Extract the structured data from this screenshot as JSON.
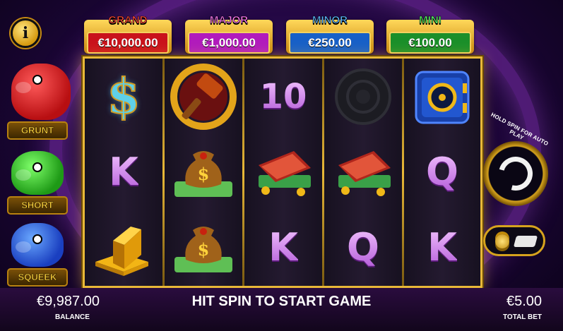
{
  "jackpots": [
    {
      "name": "GRAND",
      "value": "€10,000.00",
      "color": "#c9121c"
    },
    {
      "name": "MAJOR",
      "value": "€1,000.00",
      "color": "#b11bbd"
    },
    {
      "name": "MINOR",
      "value": "€250.00",
      "color": "#1760c8"
    },
    {
      "name": "MINI",
      "value": "€100.00",
      "color": "#1a8f2a"
    }
  ],
  "pigs": [
    {
      "label": "GRUNT",
      "icon": "red-piggy-bank-icon"
    },
    {
      "label": "SHORT",
      "icon": "green-piggy-bank-icon"
    },
    {
      "label": "SQUEEK",
      "icon": "blue-piggy-bank-icon"
    }
  ],
  "reels": {
    "symbols": [
      [
        "dollar",
        "K",
        "gold-bars"
      ],
      [
        "hammer",
        "money-bag",
        "money-bag"
      ],
      [
        "10",
        "wallet",
        "K"
      ],
      [
        "empty",
        "wallet",
        "Q"
      ],
      [
        "safe",
        "Q",
        "K"
      ]
    ],
    "labels": {
      "c0r0": "$",
      "c0r1": "K",
      "c2r0": "10",
      "c2r2": "K",
      "c3r2": "Q",
      "c4r1": "Q",
      "c4r2": "K"
    }
  },
  "controls": {
    "spin_hint": "HOLD SPIN FOR AUTO PLAY",
    "spin_icon": "refresh-icon",
    "bet_icon": "coins-card-icon"
  },
  "footer": {
    "balance_value": "€9,987.00",
    "balance_label": "BALANCE",
    "message": "HIT SPIN TO START GAME",
    "bet_value": "€5.00",
    "bet_label": "TOTAL BET"
  },
  "info_icon": "i"
}
